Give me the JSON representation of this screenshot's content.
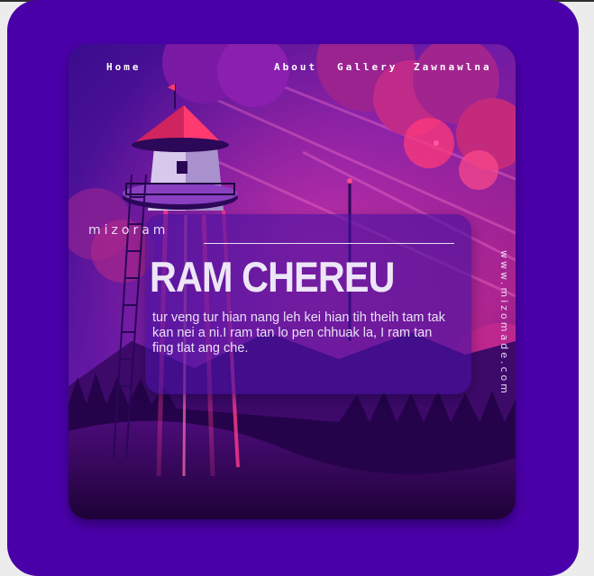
{
  "nav": {
    "home": "Home",
    "about": "About",
    "gallery": "Gallery",
    "zawnawlna": "Zawnawlna"
  },
  "brand": "mizoram",
  "hero": {
    "title": "RAM CHEREU",
    "text": "tur veng tur hian nang leh kei hian tih theih tam tak kan nei a ni.I ram tan lo pen chhuak la, I ram tan fing tlat ang che."
  },
  "side_url": "www.mizomade.com",
  "colors": {
    "frame": "#4a00a8",
    "card": "#3a0a7e",
    "accent_pink": "#ff2f8a",
    "hero_panel": "#4612a0"
  }
}
